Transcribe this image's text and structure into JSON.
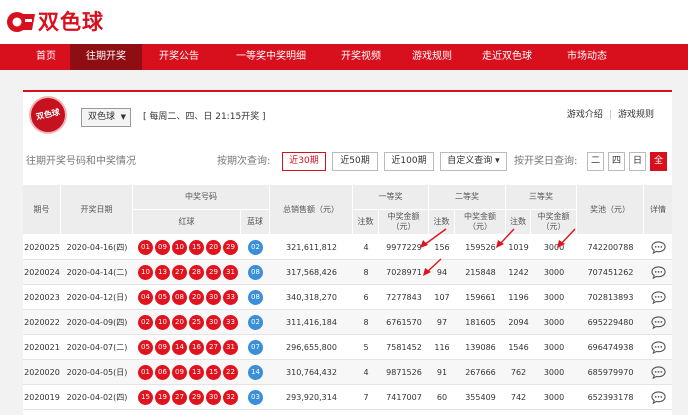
{
  "brand": {
    "name": "双色球",
    "color": "#d8101e"
  },
  "nav": [
    {
      "label": "首页",
      "active": false
    },
    {
      "label": "往期开奖",
      "active": true
    },
    {
      "label": "开奖公告",
      "active": false
    },
    {
      "label": "一等奖中奖明细",
      "active": false
    },
    {
      "label": "开奖视频",
      "active": false
    },
    {
      "label": "游戏规则",
      "active": false
    },
    {
      "label": "走近双色球",
      "active": false
    },
    {
      "label": "市场动态",
      "active": false
    }
  ],
  "game": {
    "logo_text": "双色球",
    "select_value": "双色球",
    "draw_times": "[ 每周二、四、日 21:15开奖 ]",
    "links": [
      "游戏介绍",
      "游戏规则"
    ]
  },
  "query": {
    "section_title": "往期开奖号码和中奖情况",
    "by_issue_label": "按期次查询:",
    "issue_buttons": [
      {
        "label": "近30期",
        "active": true
      },
      {
        "label": "近50期",
        "active": false
      },
      {
        "label": "近100期",
        "active": false
      },
      {
        "label": "自定义查询 ▾",
        "active": false
      }
    ],
    "by_day_label": "按开奖日查询:",
    "day_buttons": [
      {
        "label": "二",
        "active": false
      },
      {
        "label": "四",
        "active": false
      },
      {
        "label": "日",
        "active": false
      },
      {
        "label": "全",
        "active": true
      }
    ]
  },
  "table": {
    "headers": {
      "issue": "期号",
      "date": "开奖日期",
      "numbers": "中奖号码",
      "red": "红球",
      "blue": "蓝球",
      "sales": "总销售额（元）",
      "first": "一等奖",
      "second": "二等奖",
      "third": "三等奖",
      "count": "注数",
      "amount": "中奖金额（元）",
      "pool": "奖池（元）",
      "detail": "详情"
    },
    "rows": [
      {
        "issue": "2020025",
        "date": "2020-04-16(四)",
        "red": [
          "01",
          "09",
          "10",
          "15",
          "20",
          "29"
        ],
        "blue": "02",
        "sales": "321,611,812",
        "c1": "4",
        "a1": "9977229",
        "c2": "156",
        "a2": "159526",
        "c3": "1019",
        "a3": "3000",
        "pool": "742200788"
      },
      {
        "issue": "2020024",
        "date": "2020-04-14(二)",
        "red": [
          "10",
          "13",
          "27",
          "28",
          "29",
          "31"
        ],
        "blue": "08",
        "sales": "317,568,426",
        "c1": "8",
        "a1": "7028971",
        "c2": "94",
        "a2": "215848",
        "c3": "1242",
        "a3": "3000",
        "pool": "707451262"
      },
      {
        "issue": "2020023",
        "date": "2020-04-12(日)",
        "red": [
          "04",
          "05",
          "08",
          "20",
          "30",
          "33"
        ],
        "blue": "08",
        "sales": "340,318,270",
        "c1": "6",
        "a1": "7277843",
        "c2": "107",
        "a2": "159661",
        "c3": "1196",
        "a3": "3000",
        "pool": "702813893"
      },
      {
        "issue": "2020022",
        "date": "2020-04-09(四)",
        "red": [
          "02",
          "10",
          "20",
          "25",
          "30",
          "33"
        ],
        "blue": "02",
        "sales": "311,416,184",
        "c1": "8",
        "a1": "6761570",
        "c2": "97",
        "a2": "181605",
        "c3": "2094",
        "a3": "3000",
        "pool": "695229480"
      },
      {
        "issue": "2020021",
        "date": "2020-04-07(二)",
        "red": [
          "05",
          "09",
          "14",
          "16",
          "27",
          "31"
        ],
        "blue": "07",
        "sales": "296,655,800",
        "c1": "5",
        "a1": "7581452",
        "c2": "116",
        "a2": "139086",
        "c3": "1546",
        "a3": "3000",
        "pool": "696474938"
      },
      {
        "issue": "2020020",
        "date": "2020-04-05(日)",
        "red": [
          "01",
          "06",
          "09",
          "13",
          "15",
          "22"
        ],
        "blue": "14",
        "sales": "310,764,432",
        "c1": "4",
        "a1": "9871526",
        "c2": "91",
        "a2": "267666",
        "c3": "762",
        "a3": "3000",
        "pool": "685979970"
      },
      {
        "issue": "2020019",
        "date": "2020-04-02(四)",
        "red": [
          "15",
          "19",
          "27",
          "29",
          "30",
          "32"
        ],
        "blue": "03",
        "sales": "293,920,314",
        "c1": "7",
        "a1": "7417007",
        "c2": "60",
        "a2": "355409",
        "c3": "742",
        "a3": "3000",
        "pool": "652393178"
      }
    ]
  },
  "colors": {
    "red_ball": "#e0131e",
    "blue_ball": "#3b8fd8",
    "annotation_arrow": "#e0131e"
  }
}
